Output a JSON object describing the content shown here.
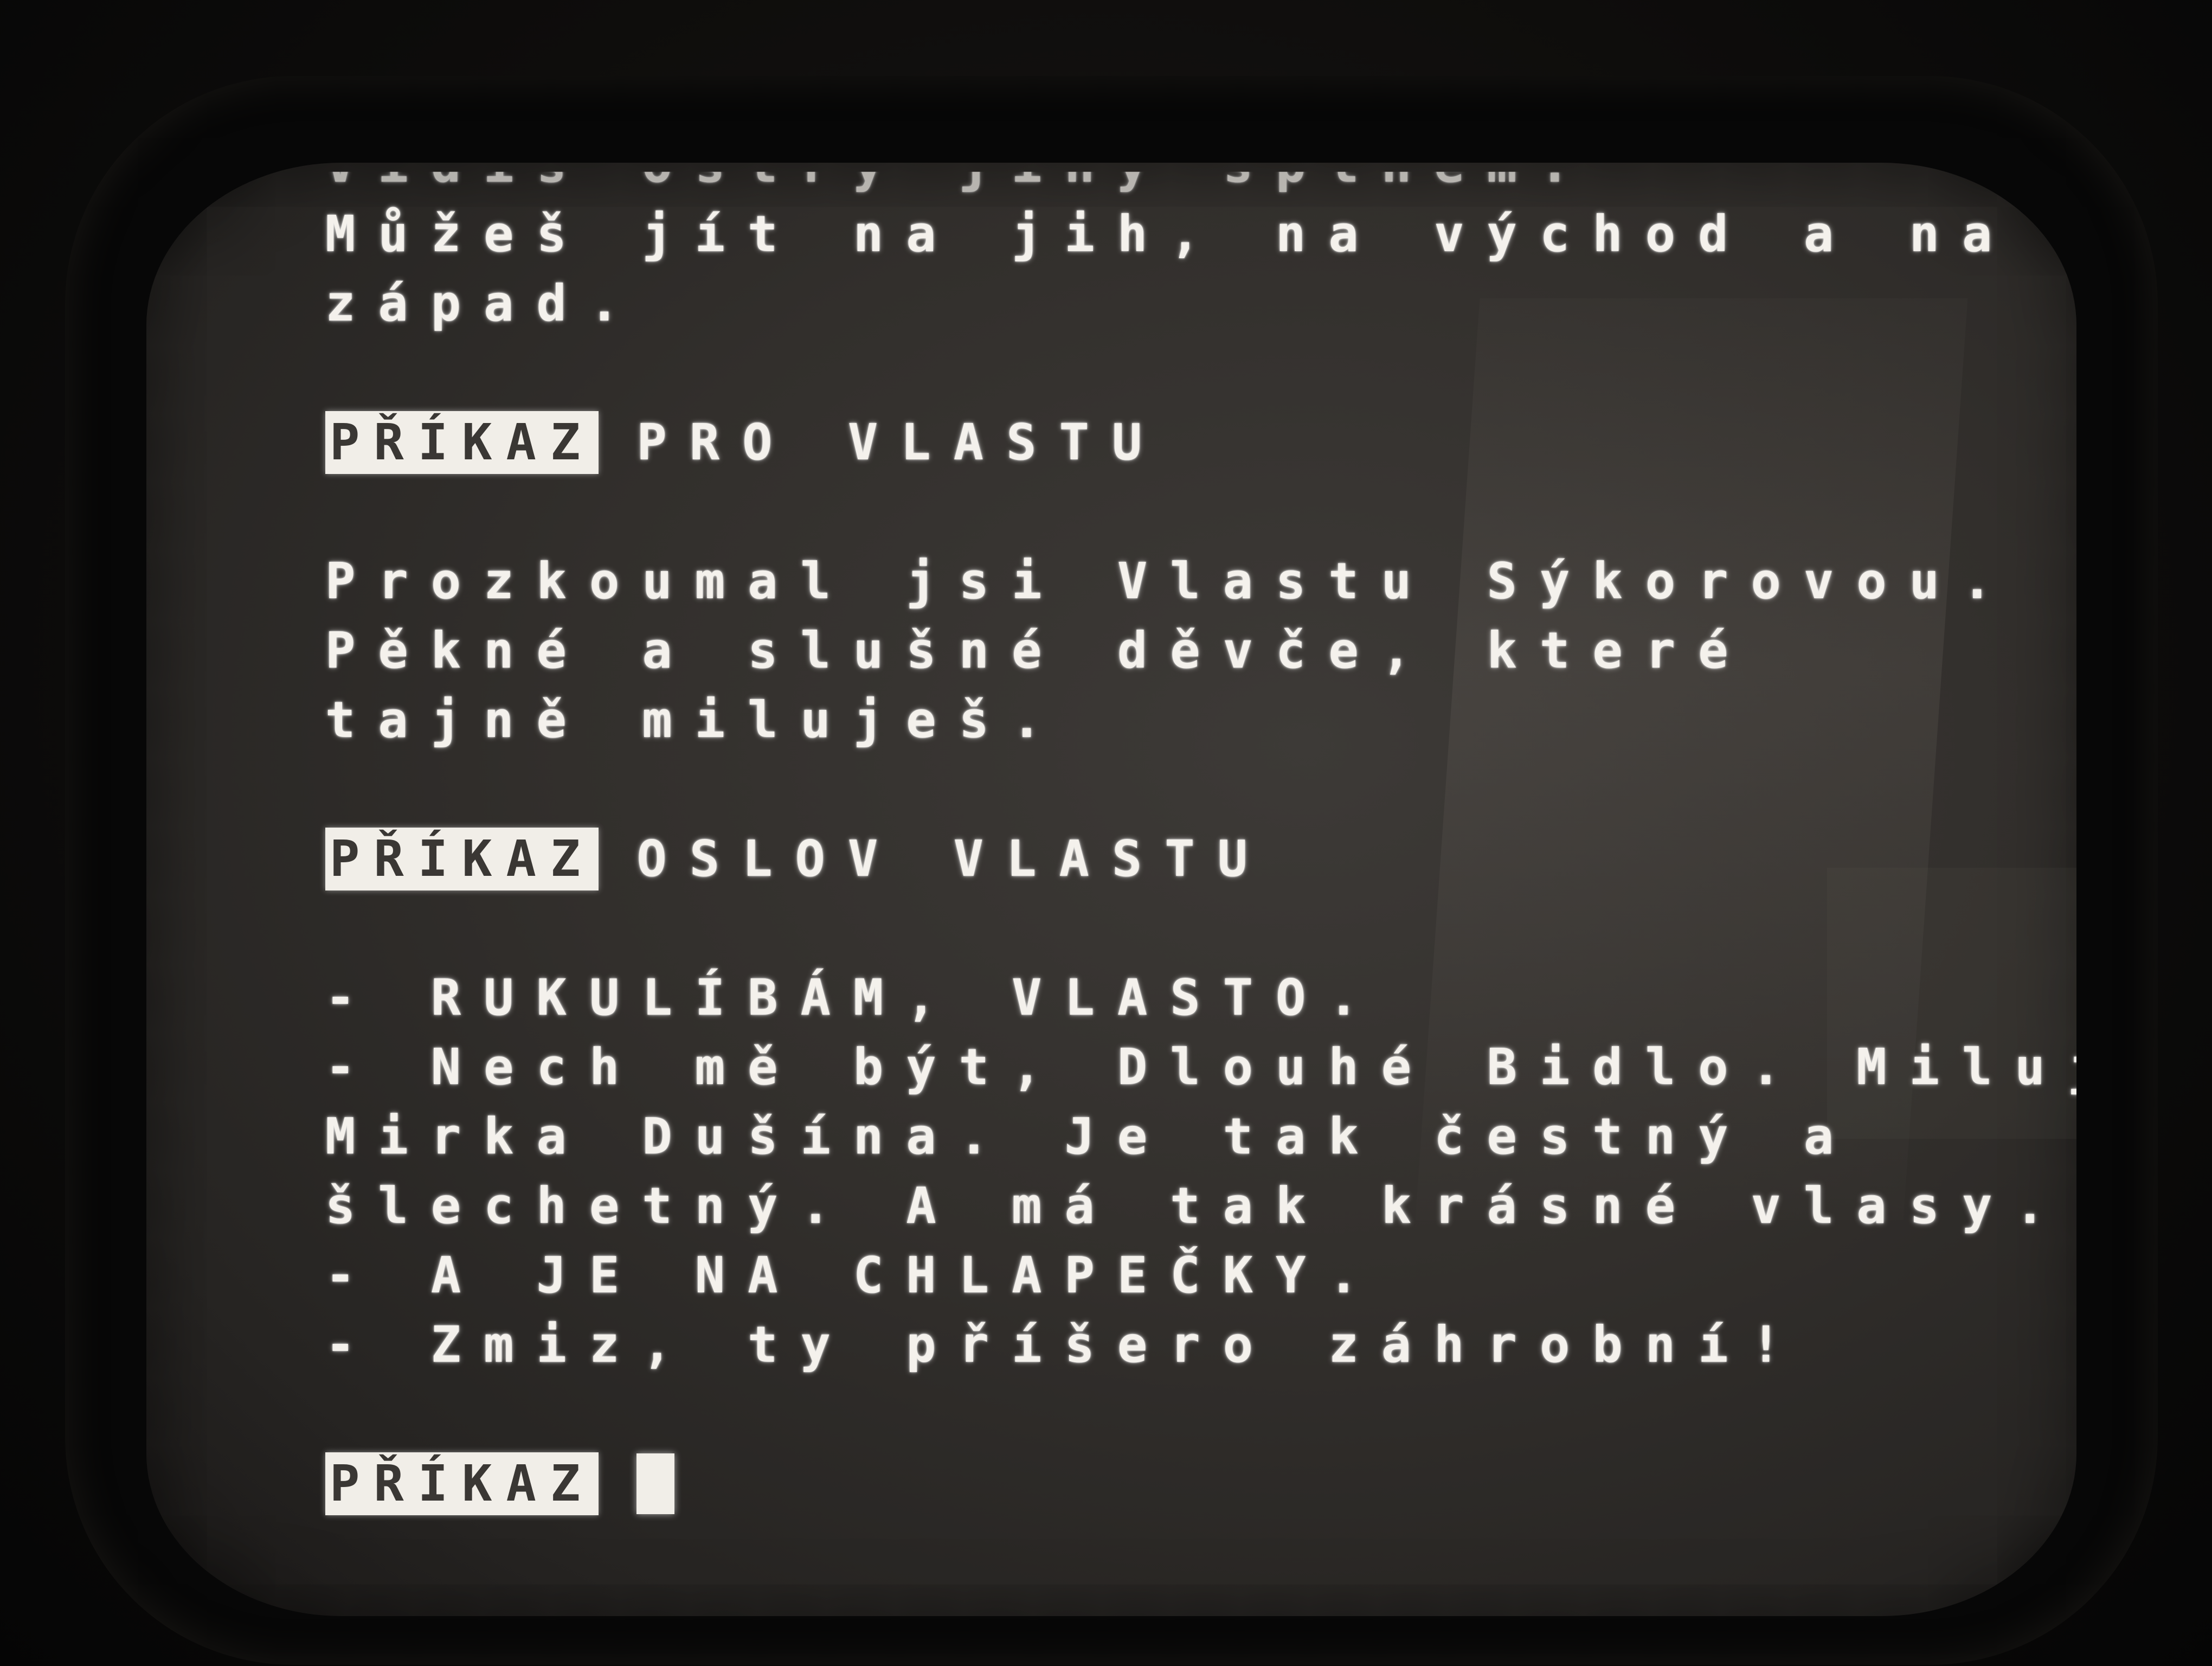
{
  "screen": {
    "previous_line_partial": "Vidíš ostrý jiný šplhem.",
    "lines": [
      {
        "type": "text",
        "text": "Můžeš jít na jih, na východ a na"
      },
      {
        "type": "text",
        "text": "západ."
      },
      {
        "type": "gap"
      },
      {
        "type": "command",
        "prompt": "PŘÍKAZ",
        "input": "PRO VLASTU"
      },
      {
        "type": "gap"
      },
      {
        "type": "text",
        "text": "Prozkoumal jsi Vlastu Sýkorovou."
      },
      {
        "type": "text",
        "text": "Pěkné a slušné děvče, které"
      },
      {
        "type": "text",
        "text": "tajně miluješ."
      },
      {
        "type": "gap"
      },
      {
        "type": "command",
        "prompt": "PŘÍKAZ",
        "input": "OSLOV VLASTU"
      },
      {
        "type": "gap"
      },
      {
        "type": "text",
        "text": "- RUKULÍBÁM, VLASTO."
      },
      {
        "type": "text",
        "text": "- Nech mě být, Dlouhé Bidlo. Miluji"
      },
      {
        "type": "text",
        "text": "Mirka Dušína. Je tak čestný a"
      },
      {
        "type": "text",
        "text": "šlechetný. A má tak krásné vlasy."
      },
      {
        "type": "text",
        "text": "- A JE NA CHLAPEČKY."
      },
      {
        "type": "text",
        "text": "- Zmiz, ty příšero záhrobní!"
      },
      {
        "type": "gap"
      },
      {
        "type": "command",
        "prompt": "PŘÍKAZ",
        "input": "",
        "cursor": true
      }
    ]
  },
  "colors": {
    "phosphor": "#f4f1ec",
    "screen_bg": "#322f2c",
    "prompt_text": "#3a3734"
  }
}
